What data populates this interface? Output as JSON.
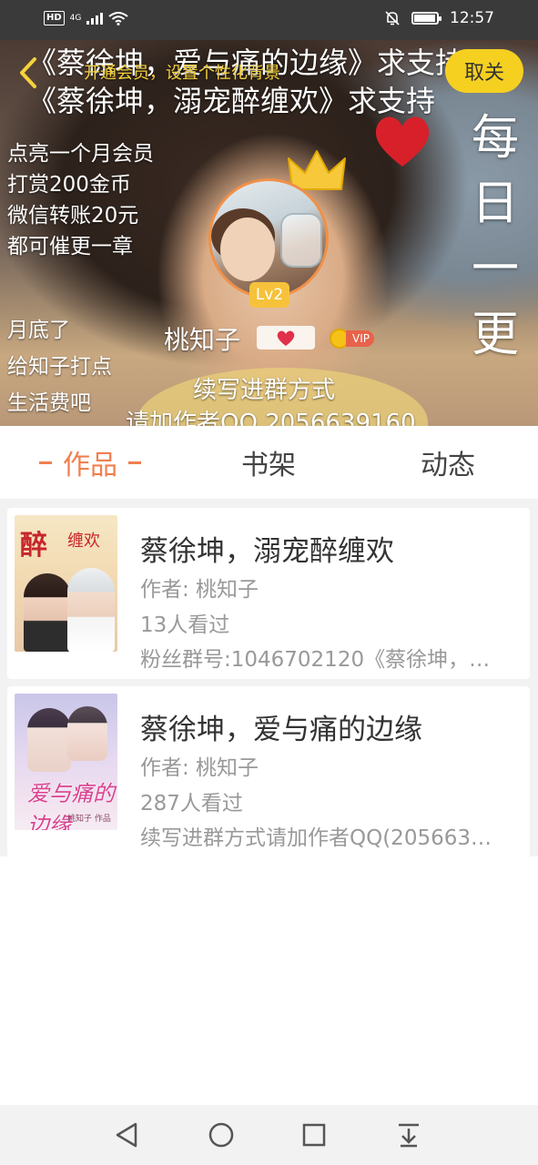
{
  "status_bar": {
    "network_badge": "HD",
    "signal_label": "4G",
    "time": "12:57",
    "battery_percent": 90
  },
  "header": {
    "title_line1": "《蔡徐坤，爱与痛的边缘》求支持",
    "title_line2": "《蔡徐坤，溺宠醉缠欢》求支持",
    "promo": "开通会员，设置个性化背景",
    "follow_button": "取关",
    "left_notes": [
      "点亮一个月会员",
      "打赏200金币",
      "微信转账20元",
      "都可催更一章"
    ],
    "left_notes2": [
      "月底了",
      "给知子打点",
      "生活费吧"
    ],
    "vertical_text": [
      "每",
      "日",
      "一",
      "更"
    ],
    "level_badge": "Lv2",
    "nickname": "桃知子",
    "vip_label": "VIP",
    "info_line1": "续写进群方式",
    "info_line2": "请加作者QQ 2056639160"
  },
  "tabs": [
    {
      "label": "作品",
      "active": true
    },
    {
      "label": "书架",
      "active": false
    },
    {
      "label": "动态",
      "active": false
    }
  ],
  "books": [
    {
      "title": "蔡徐坤，溺宠醉缠欢",
      "author": "作者: 桃知子",
      "views": "13人看过",
      "description": "粉丝群号:1046702120《蔡徐坤，…",
      "cover_text": "醉",
      "cover_text2": "缠欢"
    },
    {
      "title": "蔡徐坤，爱与痛的边缘",
      "author": "作者: 桃知子",
      "views": "287人看过",
      "description": "续写进群方式请加作者QQ(205663…",
      "cover_text": "爱与痛的边缘",
      "cover_author": "桃知子 作品"
    }
  ],
  "colors": {
    "accent": "#f07f4f",
    "follow_button": "#f5d020",
    "promo_text": "#f5d23b",
    "level_badge": "#f6c23b"
  },
  "icons": {
    "back": "chevron-left-icon",
    "nav_back": "triangle-back-icon",
    "nav_home": "circle-home-icon",
    "nav_recent": "square-recent-icon",
    "nav_notifications": "pull-down-icon"
  }
}
